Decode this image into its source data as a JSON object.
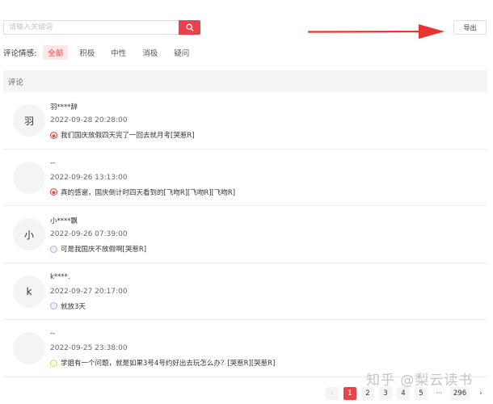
{
  "search": {
    "placeholder": "请输入关键词",
    "value": ""
  },
  "toolbar": {
    "export_label": "导出"
  },
  "filter": {
    "label": "评论情感:",
    "options": [
      "全部",
      "积极",
      "中性",
      "消极",
      "疑问"
    ],
    "active": "全部"
  },
  "table": {
    "header": "评论"
  },
  "comments": [
    {
      "avatar": "羽",
      "name": "羽****辞",
      "time": "2022-09-28 20:28:00",
      "sentiment": "negative",
      "text": "我们国庆放假四天完了一回去就月考[哭惹R]"
    },
    {
      "avatar": "",
      "name": "--",
      "time": "2022-09-26 13:13:00",
      "sentiment": "negative",
      "text": "真的感谢，国庆倒计时四天看到的[飞吻R][飞吻R][飞吻R]"
    },
    {
      "avatar": "小",
      "name": "小****飘",
      "time": "2022-09-26 07:39:00",
      "sentiment": "neutral",
      "text": "可是我国庆不放假啊[哭惹R]"
    },
    {
      "avatar": "k",
      "name": "k****.",
      "time": "2022-09-27 20:17:00",
      "sentiment": "neutral",
      "text": "就放3天"
    },
    {
      "avatar": "",
      "name": "--",
      "time": "2022-09-25 23:38:00",
      "sentiment": "question",
      "text": "学姐有一个问题，就是如果3号4号约好出去玩怎么办？[哭惹R][哭惹R]"
    }
  ],
  "pagination": {
    "prev": "‹",
    "next": "›",
    "pages": [
      "1",
      "2",
      "3",
      "4",
      "5"
    ],
    "ellipsis": "···",
    "last": "296",
    "current": "1"
  },
  "watermark": "知乎 @梨云读书",
  "colors": {
    "accent": "#e8424a",
    "arrow": "#e8342c"
  },
  "icons": {
    "search": "search-icon",
    "arrow": "red-arrow-annotation"
  }
}
